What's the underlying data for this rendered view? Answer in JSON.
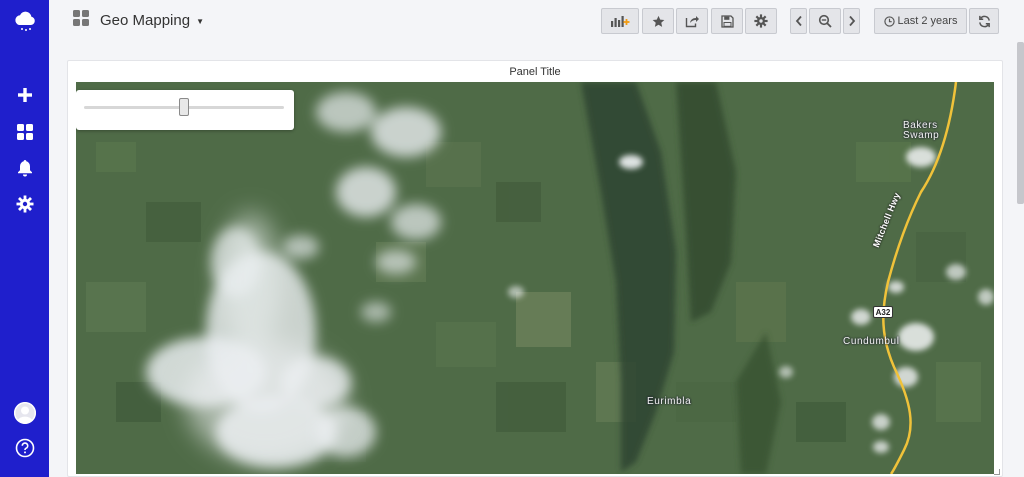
{
  "header": {
    "dashboard_title": "Geo Mapping",
    "time_range_label": "Last 2 years"
  },
  "panel": {
    "title": "Panel Title",
    "slider_value_fraction": 0.5
  },
  "map": {
    "place_labels": {
      "bakers_swamp_line1": "Bakers",
      "bakers_swamp_line2": "Swamp",
      "cundumbul": "Cundumbul",
      "eurimbla": "Eurimbla",
      "highway_name": "Mitchell Hwy",
      "route_shield": "A32"
    }
  },
  "colors": {
    "sidebar": "#1f1fcc",
    "highway": "#f0c23a",
    "page_bg": "#f4f5f8"
  },
  "icons": {
    "logo": "cloud-logo-icon",
    "sidebar": [
      "plus-icon",
      "dashboards-icon",
      "bell-icon",
      "gear-icon",
      "user-avatar-icon",
      "help-icon"
    ],
    "toolbar": [
      "add-panel-icon",
      "star-icon",
      "share-icon",
      "save-icon",
      "settings-icon",
      "chevron-left-icon",
      "zoom-out-icon",
      "chevron-right-icon",
      "clock-icon",
      "refresh-icon"
    ]
  }
}
